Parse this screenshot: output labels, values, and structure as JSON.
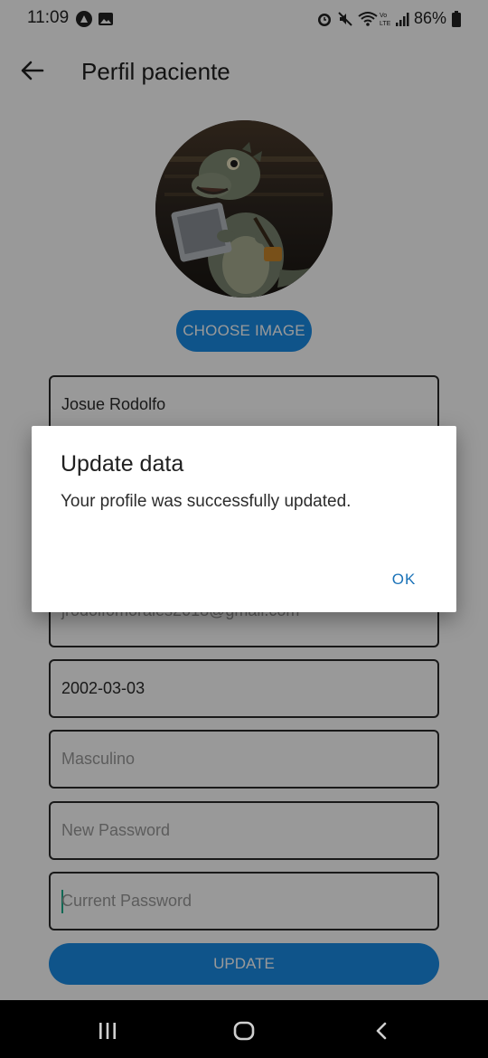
{
  "status_bar": {
    "time": "11:09",
    "battery": "86%",
    "left_icons": [
      "app-notification-icon",
      "image-icon"
    ],
    "right_icons": [
      "alarm-icon",
      "mute-icon",
      "wifi-icon",
      "volte-icon",
      "signal-icon",
      "battery-icon"
    ]
  },
  "app_bar": {
    "title": "Perfil paciente",
    "back_icon": "arrow-left-icon"
  },
  "profile": {
    "avatar_alt": "dinosaur avatar",
    "choose_image_label": "CHOOSE IMAGE"
  },
  "form": {
    "name": "Josue Rodolfo",
    "email": "jrodolfomorales2018@gmail.com",
    "birthdate": "2002-03-03",
    "gender_placeholder": "Masculino",
    "new_password_placeholder": "New Password",
    "current_password_placeholder": "Current Password",
    "update_label": "UPDATE"
  },
  "dialog": {
    "title": "Update data",
    "message": "Your profile was successfully updated.",
    "ok_label": "OK"
  },
  "nav_bar": {
    "icons": [
      "recents-icon",
      "home-icon",
      "back-icon"
    ]
  },
  "colors": {
    "accent": "#1a8ce6",
    "dialog_button": "#1a72b8",
    "scrim": "rgba(0,0,0,0.4)"
  }
}
